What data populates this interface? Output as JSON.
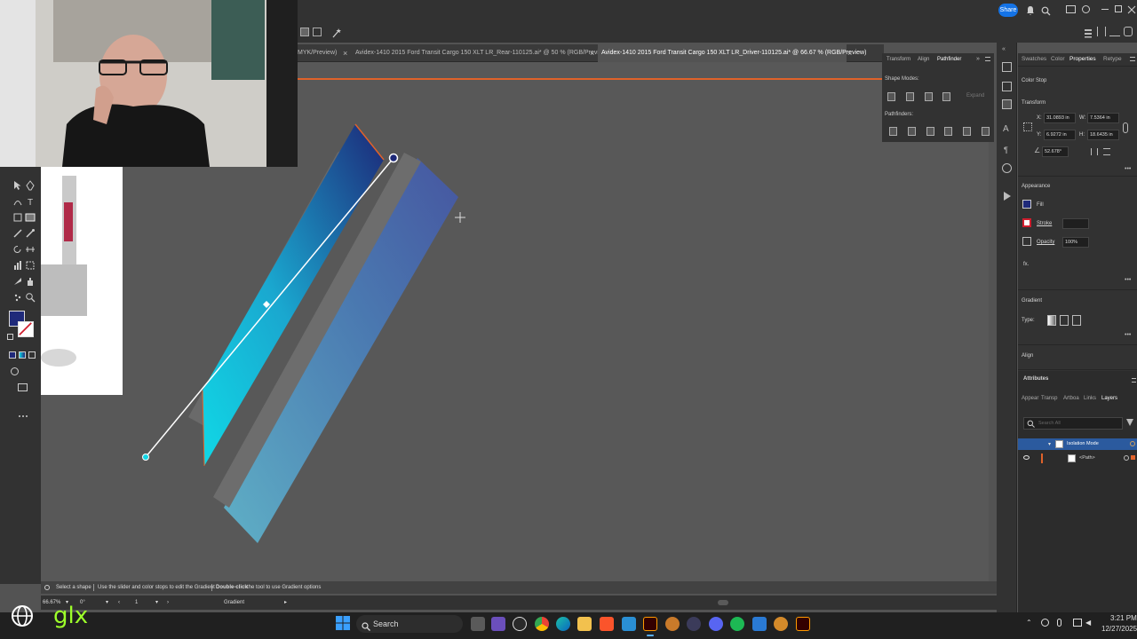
{
  "app": {
    "title": "Adobe Illustrator",
    "share_label": "Share"
  },
  "tabs": [
    {
      "label": "MYK/Preview)",
      "active": false
    },
    {
      "label": "Avidex-1410 2015 Ford Transit Cargo 150 XLT LR_Rear-110125.ai* @ 50 % (RGB/Preview)",
      "active": false
    },
    {
      "label": "Avidex-1410 2015 Ford Transit Cargo 150 XLT LR_Driver-110125.ai* @ 66.67 % (RGB/Preview)",
      "active": true
    }
  ],
  "tab_close": "×",
  "pathfinder_panel": {
    "tabs": [
      "Transform",
      "Align",
      "Pathfinder"
    ],
    "active_tab": "Pathfinder",
    "shape_modes_label": "Shape Modes:",
    "expand_label": "Expand",
    "pathfinders_label": "Pathfinders:"
  },
  "properties_panel": {
    "tabs": [
      "Swatches",
      "Color",
      "Properties",
      "Retype"
    ],
    "active_tab": "Properties",
    "section_title": "Color Stop",
    "transform_label": "Transform",
    "x_label": "X:",
    "x_value": "31.0893 in",
    "y_label": "Y:",
    "y_value": "6.9272 in",
    "w_label": "W:",
    "w_value": "7.5364 in",
    "h_label": "H:",
    "h_value": "18.6435 in",
    "angle_value": "52.678°",
    "appearance_label": "Appearance",
    "fill_label": "Fill",
    "fill_color": "#1f2a7a",
    "stroke_label": "Stroke",
    "opacity_label": "Opacity",
    "opacity_value": "100%",
    "fx_label": "fx.",
    "gradient_label": "Gradient",
    "type_label": "Type:",
    "align_label": "Align"
  },
  "layers_panel": {
    "header": "Attributes",
    "tabs": [
      "Appear",
      "Transp",
      "Artboa",
      "Links",
      "Layers"
    ],
    "active_tab": "Layers",
    "search_placeholder": "Search All",
    "items": [
      {
        "label": "Isolation Mode",
        "selected": true
      },
      {
        "label": "<Path>",
        "selected": false
      }
    ]
  },
  "status": {
    "select_hint": "Select a shape",
    "slider_hint": "Use the slider and color stops to edit the Gradient",
    "dblclick_hint": "Double-click",
    "dblclick_rest": "the tool to use Gradient options"
  },
  "bottom": {
    "zoom": "66.67%",
    "rotation": "0°",
    "artboard": "1",
    "tool": "Gradient"
  },
  "taskbar": {
    "search_label": "Search",
    "time": "3:21 PM",
    "date": "12/27/2025"
  },
  "overlay": {
    "brand": "glx"
  },
  "colors": {
    "accent": "#e0622a",
    "gradient_start": "#13d6e6",
    "gradient_end": "#1f2a7a",
    "shape_back_start": "#5ba8c8",
    "shape_back_end": "#4a63a8",
    "selection": "#1473e6"
  }
}
